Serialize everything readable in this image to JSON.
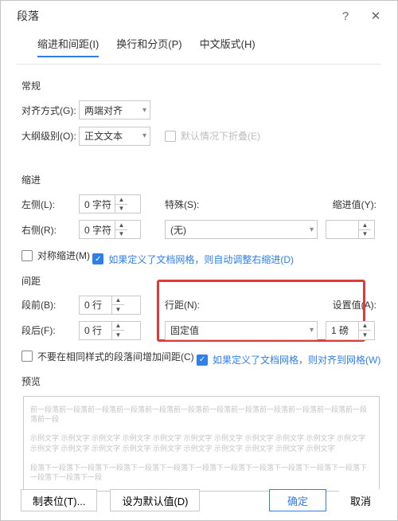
{
  "title": "段落",
  "help_icon": "?",
  "close_icon": "✕",
  "tabs": {
    "indent": "缩进和间距(I)",
    "page": "换行和分页(P)",
    "asian": "中文版式(H)"
  },
  "general": {
    "title": "常规",
    "align_label": "对齐方式(G):",
    "align_value": "两端对齐",
    "outline_label": "大纲级别(O):",
    "outline_value": "正文文本",
    "collapse_label": "默认情况下折叠(E)"
  },
  "indent": {
    "title": "缩进",
    "left_label": "左侧(L):",
    "left_value": "0 字符",
    "right_label": "右侧(R):",
    "right_value": "0 字符",
    "special_label": "特殊(S):",
    "special_value": "(无)",
    "by_label": "缩进值(Y):",
    "by_value": "",
    "mirror_label": "对称缩进(M)",
    "grid_label": "如果定义了文档网格，则自动调整右缩进(D)"
  },
  "spacing": {
    "title": "间距",
    "before_label": "段前(B):",
    "before_value": "0 行",
    "after_label": "段后(F):",
    "after_value": "0 行",
    "line_label": "行距(N):",
    "line_value": "固定值",
    "at_label": "设置值(A):",
    "at_value": "1 磅",
    "nospace_label": "不要在相同样式的段落间增加间距(C)",
    "snap_label": "如果定义了文档网格，则对齐到网格(W)"
  },
  "preview": {
    "title": "预览",
    "text": "前一段落前一段落前一段落前一段落前一段落前一段落前一段落前一段落前一段落前一段落前一段落前一段落前一段\n\n示例文字 示例文字 示例文字 示例文字 示例文字 示例文字 示例文字 示例文字 示例文字 示例文字 示例文字 示例文字 示例文字 示例文字 示例文字 示例文字 示例文字 示例文字 示例文字 示例文字 示例文字\n\n段落下一段落下一段落下一段落下一段落下一段落下一段落下一段落下一段落下一段落下一段落下一段落下一段落下一段落下一段"
  },
  "footer": {
    "tabs_btn": "制表位(T)...",
    "default_btn": "设为默认值(D)",
    "ok_btn": "确定",
    "cancel_btn": "取消"
  }
}
